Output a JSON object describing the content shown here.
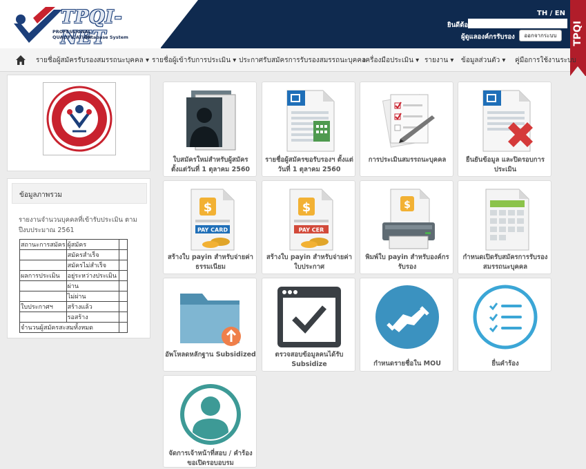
{
  "header": {
    "logo_title": "TPQI-NET",
    "logo_subtitle1": "PROFESSIONAL QUALIFICATION",
    "logo_subtitle2": "Database System",
    "lang": "TH / EN",
    "welcome": "ยินดีต้อนรับ",
    "role": "ผู้ดูแลองค์กรรับรอง",
    "logout_label": "ออกจากระบบ",
    "ribbon": "TPQI"
  },
  "nav": {
    "items": [
      "รายชื่อผู้สมัครรับรองสมรรถนะบุคคล ▾",
      "รายชื่อผู้เข้ารับการประเมิน ▾",
      "ประกาศรับสมัครการรับรองสมรรถนะบุคคล",
      "เครื่องมือประเมิน ▾",
      "รายงาน ▾",
      "ข้อมูลส่วนตัว ▾",
      "คู่มือการใช้งานระบบ"
    ]
  },
  "sidebar": {
    "summary_title": "ข้อมูลภาพรวม",
    "summary_desc": "รายงานจำนวนบุคคลที่เข้ารับประเมิน ตาม ปีงบประมาณ 2561",
    "table": [
      {
        "c1": "สถานะการสมัคร",
        "c2": "ผู้สมัคร",
        "c3": ""
      },
      {
        "c1": "",
        "c2": "สมัครสำเร็จ",
        "c3": ""
      },
      {
        "c1": "",
        "c2": "สมัครไม่สำเร็จ",
        "c3": ""
      },
      {
        "c1": "ผลการประเมิน",
        "c2": "อยู่ระหว่างประเมิน",
        "c3": ""
      },
      {
        "c1": "",
        "c2": "ผ่าน",
        "c3": ""
      },
      {
        "c1": "",
        "c2": "ไม่ผ่าน",
        "c3": ""
      },
      {
        "c1": "ใบประกาศฯ",
        "c2": "สร้างแล้ว",
        "c3": ""
      },
      {
        "c1": "",
        "c2": "รอสร้าง",
        "c3": ""
      },
      {
        "c1": "จำนวนผู้สมัครสะสมทั้งหมด",
        "c2": "",
        "c3": ""
      }
    ]
  },
  "tiles": {
    "t1": "ใบสมัครใหม่สำหรับผู้สมัคร ตั้งแต่วันที่ 1 ตุลาคม 2560",
    "t2": "รายชื่อผู้สมัครขอรับรองฯ ตั้งแต่วันที่ 1 ตุลาคม 2560",
    "t3": "การประเมินสมรรถนะบุคคล",
    "t4": "ยืนยันข้อมูล และปิดรอบการประเมิน",
    "t5": "สร้างใบ payin สำหรับจ่ายค่าธรรมเนียม",
    "t6": "สร้างใบ payin สำหรับจ่ายค่าใบประกาศ",
    "t7": "พิมพ์ใบ payin สำหรับองค์กรรับรอง",
    "t8": "กำหนดเปิดรับสมัครการรับรองสมรรถนะบุคคล",
    "t9": "อัพโหลดหลักฐาน Subsidized",
    "t10": "ตรวจสอบข้อมูลคนได้รับ Subsidize",
    "t11": "กำหนดรายชื่อใน MOU",
    "t12": "ยื่นคำร้อง",
    "t13": "จัดการเจ้าหน้าที่สอบ / คำร้องขอเปิดรอบอบรม",
    "paycard_text": "PAY CARD",
    "paycer_text": "PAY CER"
  }
}
